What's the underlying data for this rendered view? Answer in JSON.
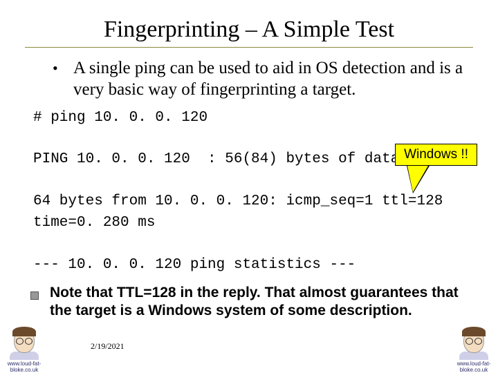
{
  "title": "Fingerprinting – A Simple Test",
  "bullet": {
    "dot": "•",
    "text": "A single ping can be used to aid in OS detection and is a very basic way of fingerprinting a target."
  },
  "callout": "Windows !!",
  "code": {
    "line1": "# ping 10. 0. 0. 120",
    "line2": "PING 10. 0. 0. 120  : 56(84) bytes of data.",
    "line3": "64 bytes from 10. 0. 0. 120: icmp_seq=1 ttl=128 time=0. 280 ms",
    "line4": "--- 10. 0. 0. 120 ping statistics ---"
  },
  "note": "Note that TTL=128 in the reply. That almost guarantees that the target is a Windows system of some description.",
  "date": "2/19/2021",
  "watermark": "www.loud-fat-bloke.co.uk"
}
